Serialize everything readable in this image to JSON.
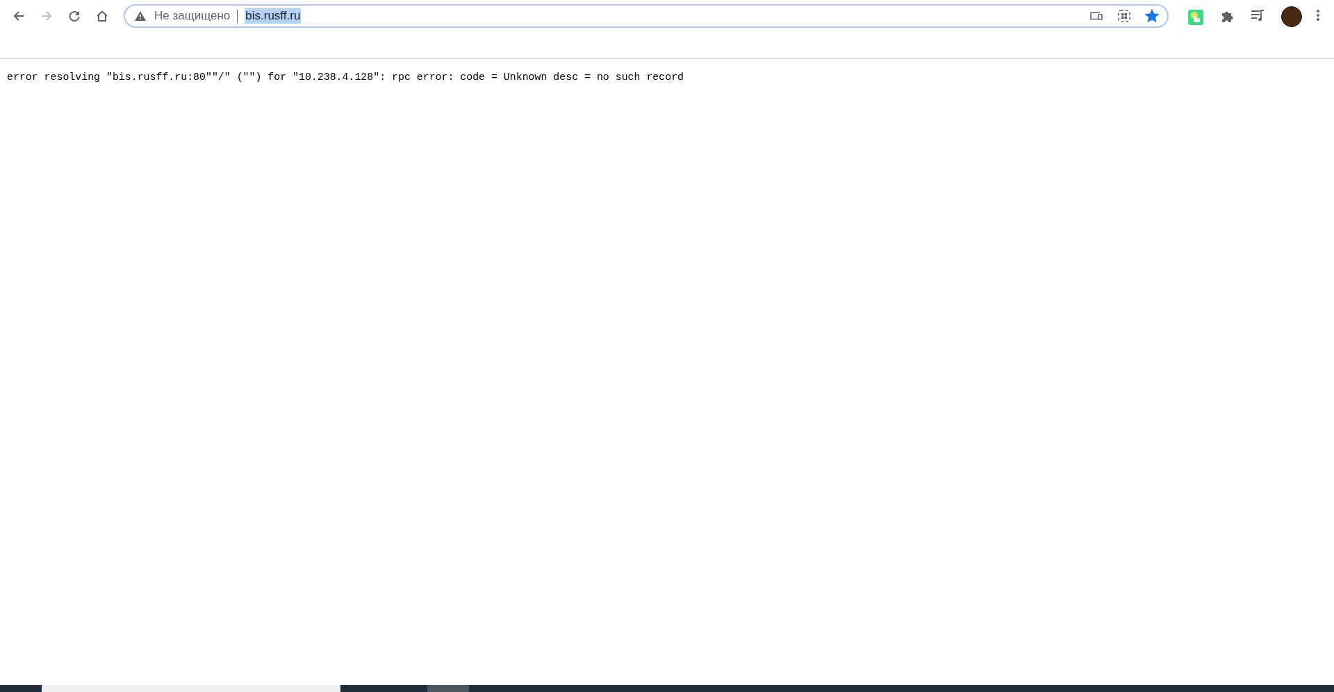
{
  "toolbar": {
    "back": {
      "disabled": false
    },
    "forward": {
      "disabled": true
    },
    "address_bar": {
      "security_label": "Не защищено",
      "url": "bis.rusff.ru",
      "url_selected": true,
      "bookmarked": true
    }
  },
  "page": {
    "text": "error resolving \"bis.rusff.ru:80\"\"/\" (\"\") for \"10.238.4.128\": rpc error: code = Unknown desc = no such record"
  }
}
